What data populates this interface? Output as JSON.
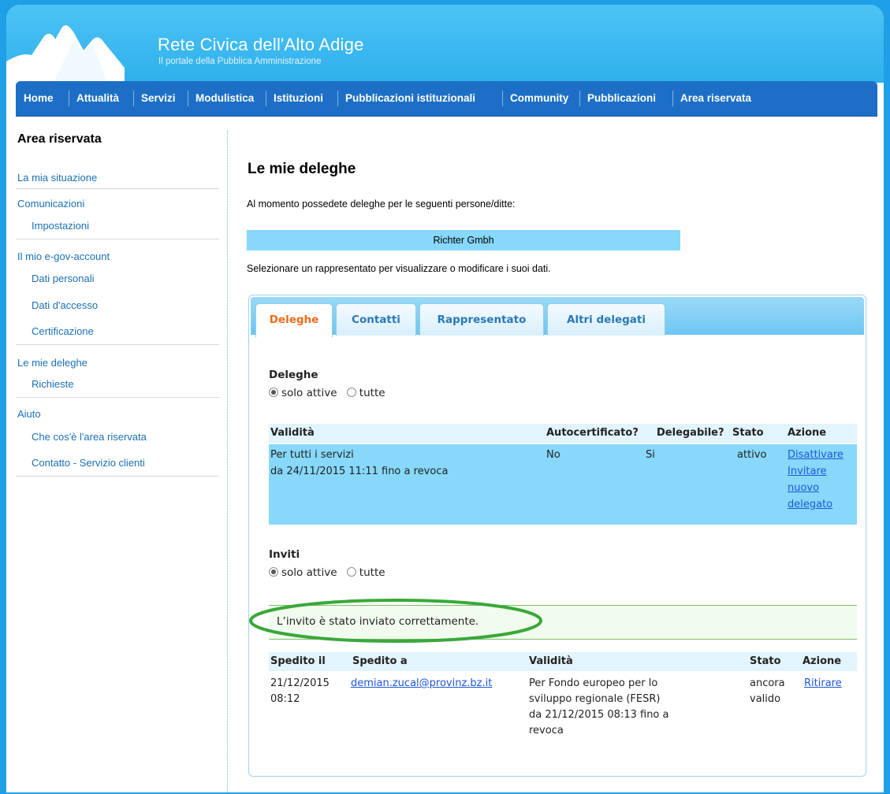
{
  "header": {
    "title": "Rete Civica dell'Alto Adige",
    "subtitle": "Il portale della Pubblica Amministrazione"
  },
  "nav": {
    "items": [
      "Home",
      "Attualità",
      "Servizi",
      "Modulistica",
      "Istituzioni",
      "Pubblicazioni istituzionali",
      "Community",
      "Pubblicazioni",
      "Area riservata"
    ]
  },
  "sidebar": {
    "title": "Area riservata",
    "links": {
      "la_mia_situazione": "La mia situazione",
      "comunicazioni": "Comunicazioni",
      "impostazioni": "Impostazioni",
      "egov_account": "Il mio e-gov-account",
      "dati_personali": "Dati personali",
      "dati_accesso": "Dati d'accesso",
      "certificazione": "Certificazione",
      "le_mie_deleghe": "Le mie deleghe",
      "richieste": "Richieste",
      "aiuto": "Aiuto",
      "che_cose": "Che cos'è l'area riservata",
      "contatto": "Contatto - Servizio clienti"
    }
  },
  "main": {
    "title": "Le mie deleghe",
    "intro": "Al momento possedete deleghe per le seguenti persone/ditte:",
    "person": "Richter Gmbh",
    "select_hint": "Selezionare un rappresentato per visualizzare o modificare i suoi dati."
  },
  "tabs": [
    "Deleghe",
    "Contatti",
    "Rappresentato",
    "Altri delegati"
  ],
  "deleghe": {
    "title": "Deleghe",
    "filter_active": "solo attive",
    "filter_all": "tutte",
    "headers": {
      "validita": "Validità",
      "autocert": "Autocertificato?",
      "delegabile": "Delegabile?",
      "stato": "Stato",
      "azione": "Azione"
    },
    "row": {
      "validita_1": "Per tutti i servizi",
      "validita_2": "da 24/11/2015 11:11 fino a revoca",
      "autocert": "No",
      "delegabile": "Si",
      "stato": "attivo",
      "action_disattivare": "Disattivare",
      "action_invitare_1": "Invitare",
      "action_invitare_2": "nuovo",
      "action_invitare_3": "delegato"
    }
  },
  "inviti": {
    "title": "Inviti",
    "filter_active": "solo attive",
    "filter_all": "tutte",
    "success": "L’invito è stato inviato correttamente.",
    "headers": {
      "spedito_il": "Spedito il",
      "spedito_a": "Spedito a",
      "validita": "Validità",
      "stato": "Stato",
      "azione": "Azione"
    },
    "row": {
      "date_1": "21/12/2015",
      "date_2": "08:12",
      "email": "demian.zucal@provinz.bz.it",
      "validita_1": "Per Fondo europeo per lo",
      "validita_2": "sviluppo regionale (FESR)",
      "validita_3": "da 21/12/2015 08:13 fino a",
      "validita_4": "revoca",
      "stato_1": "ancora",
      "stato_2": "valido",
      "action": "Ritirare"
    }
  },
  "colors": {
    "nav_bg": "#1d6fc6",
    "highlight_row": "#87d8fb",
    "active_tab": "#ee6a1a",
    "success_ellipse": "#3aa83a"
  }
}
